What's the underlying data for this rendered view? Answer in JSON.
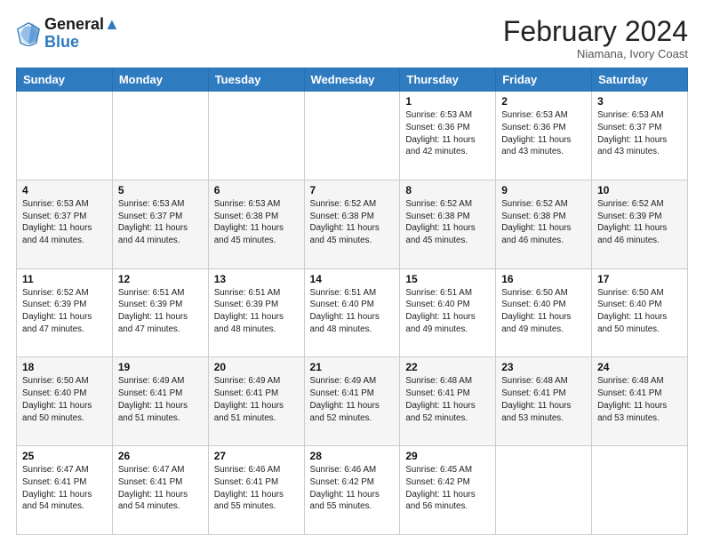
{
  "header": {
    "logo_line1": "General",
    "logo_line2": "Blue",
    "title": "February 2024",
    "subtitle": "Niamana, Ivory Coast"
  },
  "days_of_week": [
    "Sunday",
    "Monday",
    "Tuesday",
    "Wednesday",
    "Thursday",
    "Friday",
    "Saturday"
  ],
  "weeks": [
    [
      {
        "day": "",
        "info": ""
      },
      {
        "day": "",
        "info": ""
      },
      {
        "day": "",
        "info": ""
      },
      {
        "day": "",
        "info": ""
      },
      {
        "day": "1",
        "info": "Sunrise: 6:53 AM\nSunset: 6:36 PM\nDaylight: 11 hours\nand 42 minutes."
      },
      {
        "day": "2",
        "info": "Sunrise: 6:53 AM\nSunset: 6:36 PM\nDaylight: 11 hours\nand 43 minutes."
      },
      {
        "day": "3",
        "info": "Sunrise: 6:53 AM\nSunset: 6:37 PM\nDaylight: 11 hours\nand 43 minutes."
      }
    ],
    [
      {
        "day": "4",
        "info": "Sunrise: 6:53 AM\nSunset: 6:37 PM\nDaylight: 11 hours\nand 44 minutes."
      },
      {
        "day": "5",
        "info": "Sunrise: 6:53 AM\nSunset: 6:37 PM\nDaylight: 11 hours\nand 44 minutes."
      },
      {
        "day": "6",
        "info": "Sunrise: 6:53 AM\nSunset: 6:38 PM\nDaylight: 11 hours\nand 45 minutes."
      },
      {
        "day": "7",
        "info": "Sunrise: 6:52 AM\nSunset: 6:38 PM\nDaylight: 11 hours\nand 45 minutes."
      },
      {
        "day": "8",
        "info": "Sunrise: 6:52 AM\nSunset: 6:38 PM\nDaylight: 11 hours\nand 45 minutes."
      },
      {
        "day": "9",
        "info": "Sunrise: 6:52 AM\nSunset: 6:38 PM\nDaylight: 11 hours\nand 46 minutes."
      },
      {
        "day": "10",
        "info": "Sunrise: 6:52 AM\nSunset: 6:39 PM\nDaylight: 11 hours\nand 46 minutes."
      }
    ],
    [
      {
        "day": "11",
        "info": "Sunrise: 6:52 AM\nSunset: 6:39 PM\nDaylight: 11 hours\nand 47 minutes."
      },
      {
        "day": "12",
        "info": "Sunrise: 6:51 AM\nSunset: 6:39 PM\nDaylight: 11 hours\nand 47 minutes."
      },
      {
        "day": "13",
        "info": "Sunrise: 6:51 AM\nSunset: 6:39 PM\nDaylight: 11 hours\nand 48 minutes."
      },
      {
        "day": "14",
        "info": "Sunrise: 6:51 AM\nSunset: 6:40 PM\nDaylight: 11 hours\nand 48 minutes."
      },
      {
        "day": "15",
        "info": "Sunrise: 6:51 AM\nSunset: 6:40 PM\nDaylight: 11 hours\nand 49 minutes."
      },
      {
        "day": "16",
        "info": "Sunrise: 6:50 AM\nSunset: 6:40 PM\nDaylight: 11 hours\nand 49 minutes."
      },
      {
        "day": "17",
        "info": "Sunrise: 6:50 AM\nSunset: 6:40 PM\nDaylight: 11 hours\nand 50 minutes."
      }
    ],
    [
      {
        "day": "18",
        "info": "Sunrise: 6:50 AM\nSunset: 6:40 PM\nDaylight: 11 hours\nand 50 minutes."
      },
      {
        "day": "19",
        "info": "Sunrise: 6:49 AM\nSunset: 6:41 PM\nDaylight: 11 hours\nand 51 minutes."
      },
      {
        "day": "20",
        "info": "Sunrise: 6:49 AM\nSunset: 6:41 PM\nDaylight: 11 hours\nand 51 minutes."
      },
      {
        "day": "21",
        "info": "Sunrise: 6:49 AM\nSunset: 6:41 PM\nDaylight: 11 hours\nand 52 minutes."
      },
      {
        "day": "22",
        "info": "Sunrise: 6:48 AM\nSunset: 6:41 PM\nDaylight: 11 hours\nand 52 minutes."
      },
      {
        "day": "23",
        "info": "Sunrise: 6:48 AM\nSunset: 6:41 PM\nDaylight: 11 hours\nand 53 minutes."
      },
      {
        "day": "24",
        "info": "Sunrise: 6:48 AM\nSunset: 6:41 PM\nDaylight: 11 hours\nand 53 minutes."
      }
    ],
    [
      {
        "day": "25",
        "info": "Sunrise: 6:47 AM\nSunset: 6:41 PM\nDaylight: 11 hours\nand 54 minutes."
      },
      {
        "day": "26",
        "info": "Sunrise: 6:47 AM\nSunset: 6:41 PM\nDaylight: 11 hours\nand 54 minutes."
      },
      {
        "day": "27",
        "info": "Sunrise: 6:46 AM\nSunset: 6:41 PM\nDaylight: 11 hours\nand 55 minutes."
      },
      {
        "day": "28",
        "info": "Sunrise: 6:46 AM\nSunset: 6:42 PM\nDaylight: 11 hours\nand 55 minutes."
      },
      {
        "day": "29",
        "info": "Sunrise: 6:45 AM\nSunset: 6:42 PM\nDaylight: 11 hours\nand 56 minutes."
      },
      {
        "day": "",
        "info": ""
      },
      {
        "day": "",
        "info": ""
      }
    ]
  ]
}
